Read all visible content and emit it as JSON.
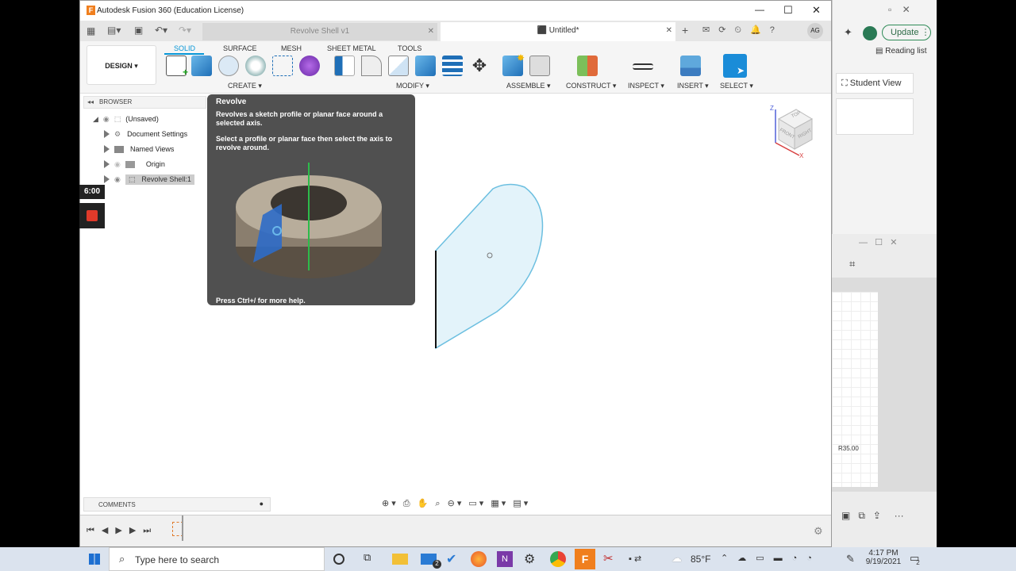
{
  "titlebar": {
    "app_title": "Autodesk Fusion 360 (Education License)",
    "minimize": "—",
    "maximize": "☐",
    "close": "✕"
  },
  "tabs": [
    {
      "label": "Revolve Shell v1"
    },
    {
      "label": "Untitled*"
    }
  ],
  "user_initials": "AG",
  "workspace": {
    "label": "DESIGN ▾"
  },
  "toolbar_tabs": [
    "SOLID",
    "SURFACE",
    "MESH",
    "SHEET METAL",
    "TOOLS"
  ],
  "toolbar_groups": {
    "create": "CREATE ▾",
    "modify": "MODIFY ▾",
    "assemble": "ASSEMBLE ▾",
    "construct": "CONSTRUCT ▾",
    "inspect": "INSPECT ▾",
    "insert": "INSERT ▾",
    "select": "SELECT ▾"
  },
  "browser": {
    "title": "BROWSER",
    "items": [
      {
        "label": "(Unsaved)"
      },
      {
        "label": "Document Settings"
      },
      {
        "label": "Named Views"
      },
      {
        "label": "Origin"
      },
      {
        "label": "Revolve Shell:1"
      }
    ]
  },
  "tooltip": {
    "title": "Revolve",
    "desc1": "Revolves a sketch profile or planar face around a selected axis.",
    "desc2": "Select a profile or planar face then select the axis to revolve around.",
    "help": "Press Ctrl+/ for more help."
  },
  "recorder": {
    "time": "6:00"
  },
  "viewcube": {
    "top": "TOP",
    "front": "FRONT",
    "right": "RIGHT",
    "z": "Z",
    "x": "X"
  },
  "comments": {
    "label": "COMMENTS"
  },
  "bg_browser": {
    "update": "Update",
    "reading_list": "Reading list",
    "student_view": "Student View",
    "dimension": "R35.00"
  },
  "taskbar": {
    "search_placeholder": "Type here to search",
    "weather": "85°F",
    "time": "4:17 PM",
    "date": "9/19/2021",
    "mail_badge": "2",
    "notif_badge": "2"
  },
  "colors": {
    "accent": "#0696d7",
    "sketch_fill": "#e3f3fa",
    "sketch_stroke": "#6cbfe0"
  }
}
